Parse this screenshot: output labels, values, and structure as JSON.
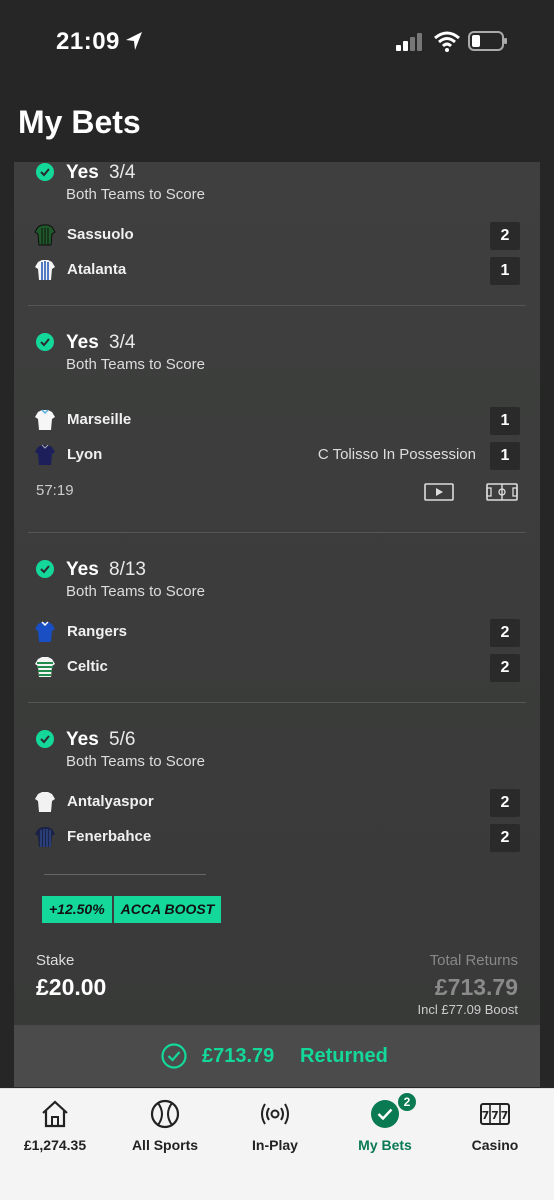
{
  "status": {
    "time": "21:09"
  },
  "page": {
    "title": "My Bets"
  },
  "selections": [
    {
      "name": "Yes",
      "odds": "3/4",
      "market": "Both Teams to Score",
      "teams": [
        {
          "name": "Sassuolo",
          "score": "2"
        },
        {
          "name": "Atalanta",
          "score": "1"
        }
      ]
    },
    {
      "name": "Yes",
      "odds": "3/4",
      "market": "Both Teams to Score",
      "teams": [
        {
          "name": "Marseille",
          "score": "1"
        },
        {
          "name": "Lyon",
          "score": "1",
          "possession": "C Tolisso In Possession"
        }
      ],
      "clock": "57:19"
    },
    {
      "name": "Yes",
      "odds": "8/13",
      "market": "Both Teams to Score",
      "teams": [
        {
          "name": "Rangers",
          "score": "2"
        },
        {
          "name": "Celtic",
          "score": "2"
        }
      ]
    },
    {
      "name": "Yes",
      "odds": "5/6",
      "market": "Both Teams to Score",
      "teams": [
        {
          "name": "Antalyaspor",
          "score": "2"
        },
        {
          "name": "Fenerbahce",
          "score": "2"
        }
      ]
    }
  ],
  "boost": {
    "percent": "+12.50%",
    "label": "ACCA BOOST"
  },
  "bet": {
    "stake_label": "Stake",
    "stake": "£20.00",
    "returns_label": "Total Returns",
    "returns": "£713.79",
    "boost_note": "Incl £77.09 Boost",
    "returned_amount": "£713.79",
    "returned_label": "Returned"
  },
  "nav": {
    "items": [
      {
        "label": "£1,274.35",
        "icon": "home-icon"
      },
      {
        "label": "All Sports",
        "icon": "ball-icon"
      },
      {
        "label": "In-Play",
        "icon": "broadcast-icon"
      },
      {
        "label": "My Bets",
        "icon": "check-circle-icon",
        "badge": "2"
      },
      {
        "label": "Casino",
        "icon": "slots-icon"
      }
    ]
  },
  "colors": {
    "accent": "#14d89a",
    "active_nav": "#0a7a53",
    "card": "#3d3e3d"
  }
}
